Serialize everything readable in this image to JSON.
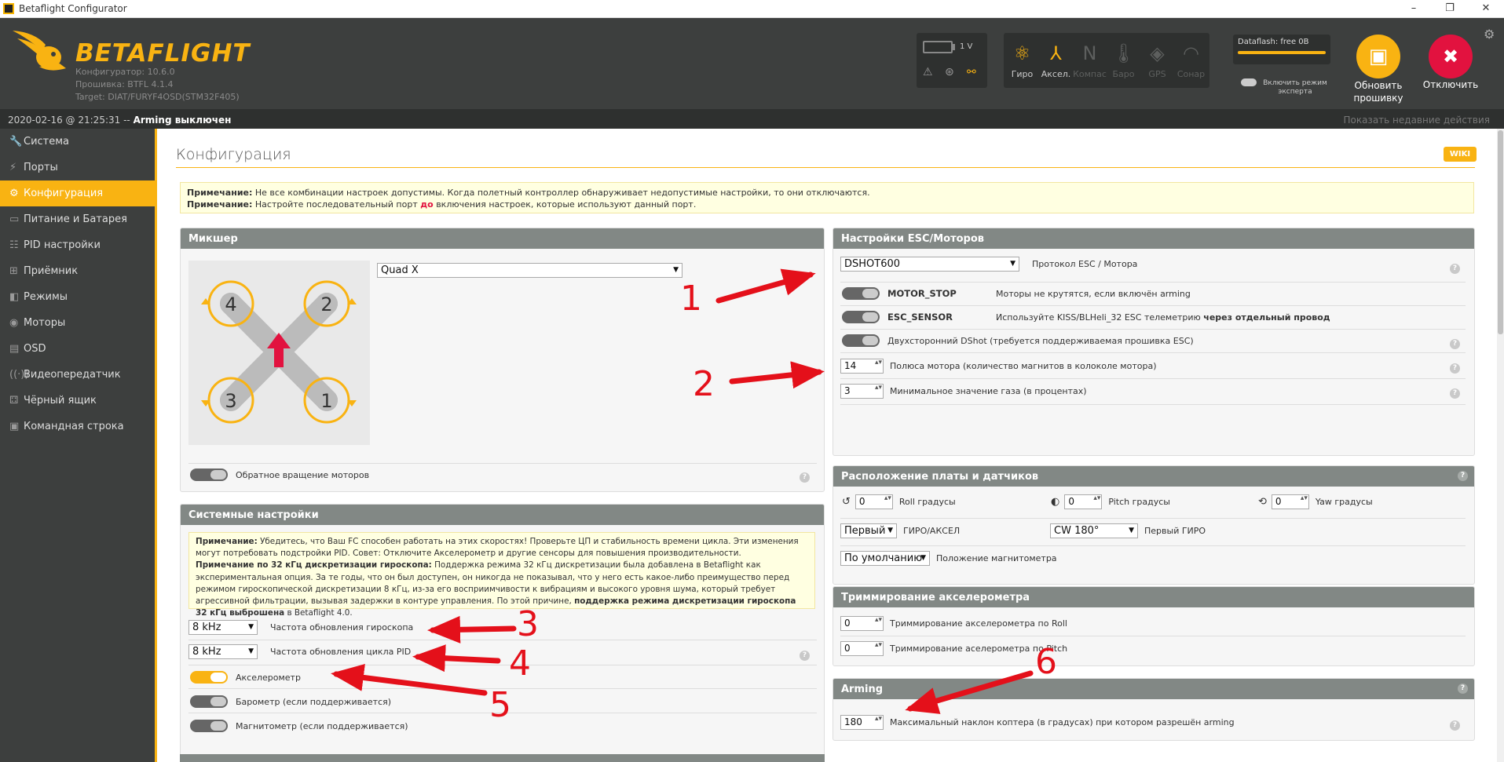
{
  "window": {
    "title": "Betaflight Configurator",
    "min": "–",
    "max": "❐",
    "close": "✕"
  },
  "header": {
    "brand": "BETAFLIGHT",
    "configurator": "Конфигуратор: 10.6.0",
    "firmware": "Прошивка: BTFL 4.1.4",
    "target": "Target: DIAT/FURYF4OSD(STM32F405)",
    "battery": "1 V",
    "sensors": [
      {
        "label": "Гиро",
        "icon": "gyro-icon",
        "active": true
      },
      {
        "label": "Аксел.",
        "icon": "accel-icon",
        "active": true
      },
      {
        "label": "Компас",
        "icon": "compass-icon",
        "active": false
      },
      {
        "label": "Баро",
        "icon": "baro-icon",
        "active": false
      },
      {
        "label": "GPS",
        "icon": "gps-icon",
        "active": false
      },
      {
        "label": "Сонар",
        "icon": "sonar-icon",
        "active": false
      }
    ],
    "dataflash": "Dataflash: free 0B",
    "expert_mode": "Включить режим эксперта",
    "update_firmware": "Обновить прошивку",
    "disconnect": "Отключить"
  },
  "status": {
    "timestamp": "2020-02-16 @ 21:25:31 --",
    "arming": "Arming выключен",
    "recent": "Показать недавние действия"
  },
  "sidebar": {
    "items": [
      {
        "label": "Система",
        "icon": "wrench-icon",
        "active": false
      },
      {
        "label": "Порты",
        "icon": "plug-icon",
        "active": false
      },
      {
        "label": "Конфигурация",
        "icon": "gear-icon",
        "active": true
      },
      {
        "label": "Питание и Батарея",
        "icon": "battery-icon",
        "active": false
      },
      {
        "label": "PID настройки",
        "icon": "sliders-icon",
        "active": false
      },
      {
        "label": "Приёмник",
        "icon": "receiver-icon",
        "active": false
      },
      {
        "label": "Режимы",
        "icon": "modes-icon",
        "active": false
      },
      {
        "label": "Моторы",
        "icon": "motor-icon",
        "active": false
      },
      {
        "label": "OSD",
        "icon": "osd-icon",
        "active": false
      },
      {
        "label": "Видеопередатчик",
        "icon": "vtx-icon",
        "active": false
      },
      {
        "label": "Чёрный ящик",
        "icon": "blackbox-icon",
        "active": false
      },
      {
        "label": "Командная строка",
        "icon": "cli-icon",
        "active": false
      }
    ]
  },
  "page": {
    "title": "Конфигурация",
    "wiki": "WIKI",
    "note1_bold": "Примечание:",
    "note1": " Не все комбинации настроек допустимы. Когда полетный контроллер обнаруживает недопустимые настройки, то они отключаются.",
    "note2_bold": "Примечание:",
    "note2a": " Настройте последовательный порт ",
    "note2_red": "до",
    "note2b": " включения настроек, которые используют данный порт."
  },
  "mixer": {
    "title": "Микшер",
    "type": "Quad X",
    "reverse": "Обратное вращение моторов",
    "motors": [
      "4",
      "2",
      "3",
      "1"
    ]
  },
  "system": {
    "title": "Системные настройки",
    "n1_bold": "Примечание:",
    "n1": " Убедитесь, что Ваш FC способен работать на этих скоростях! Проверьте ЦП и стабильность времени цикла. Эти изменения могут потребовать подстройки PID. Совет: Отключите Акселерометр и другие сенсоры для повышения производительности.",
    "n2_bold": "Примечание по 32 кГц дискретизации гироскопа:",
    "n2": " Поддержка режима 32 кГц дискретизации была добавлена в Betaflight как экспериментальная опция. За те годы, что он был доступен, он никогда не показывал, что у него есть какое-либо преимущество перед режимом гироскопической дискретизации 8 кГц, из-за его восприимчивости к вибрациям и высокого уровня шума, который требует агрессивной фильтрации, вызывая задержки в контуре управления. По этой причине, ",
    "n2_bold2": "поддержка режима дискретизации гироскопа 32 кГц выброшена",
    "n2_end": " в Betaflight 4.0.",
    "gyro_rate": "8 kHz",
    "gyro_label": "Частота обновления гироскопа",
    "pid_rate": "8 kHz",
    "pid_label": "Частота обновления цикла PID",
    "accel": "Акселерометр",
    "baro": "Барометр (если поддерживается)",
    "mag": "Магнитометр (если поддерживается)"
  },
  "esc": {
    "title": "Настройки ESC/Моторов",
    "protocol": "DSHOT600",
    "protocol_label": "Протокол ESC / Мотора",
    "motor_stop": "MOTOR_STOP",
    "motor_stop_desc": "Моторы не крутятся, если включён arming",
    "esc_sensor": "ESC_SENSOR",
    "esc_sensor_desc": "Используйте KISS/BLHeli_32 ESC телеметрию ",
    "esc_sensor_bold": "через отдельный провод",
    "bidir": "Двухсторонний DShot (требуется поддерживаемая прошивка ESC)",
    "poles": "14",
    "poles_label": "Полюса мотора (количество магнитов в колоколе мотора)",
    "min_throttle": "3",
    "min_throttle_label": "Минимальное значение газа (в процентах)"
  },
  "board": {
    "title": "Расположение платы и датчиков",
    "roll": "0",
    "roll_label": "Roll градусы",
    "pitch": "0",
    "pitch_label": "Pitch градусы",
    "yaw": "0",
    "yaw_label": "Yaw градусы",
    "gyro_sel": "Первый",
    "gyro_sel_label": "ГИРО/АКСЕЛ",
    "align": "CW 180°",
    "align_label": "Первый ГИРО",
    "mag": "По умолчанию",
    "mag_label": "Положение магнитометра"
  },
  "acc_trim": {
    "title": "Триммирование акселерометра",
    "roll": "0",
    "roll_label": "Триммирование акселерометра по Roll",
    "pitch": "0",
    "pitch_label": "Триммирование аселерометра по Pitch"
  },
  "arming": {
    "title": "Arming",
    "angle": "180",
    "angle_label": "Максимальный наклон коптера (в градусах) при котором разрешён arming"
  },
  "annotations": [
    "1",
    "2",
    "3",
    "4",
    "5",
    "6"
  ],
  "colors": {
    "accent": "#f9b312",
    "arrow": "#e4101a",
    "header": "#3d3f3e"
  }
}
